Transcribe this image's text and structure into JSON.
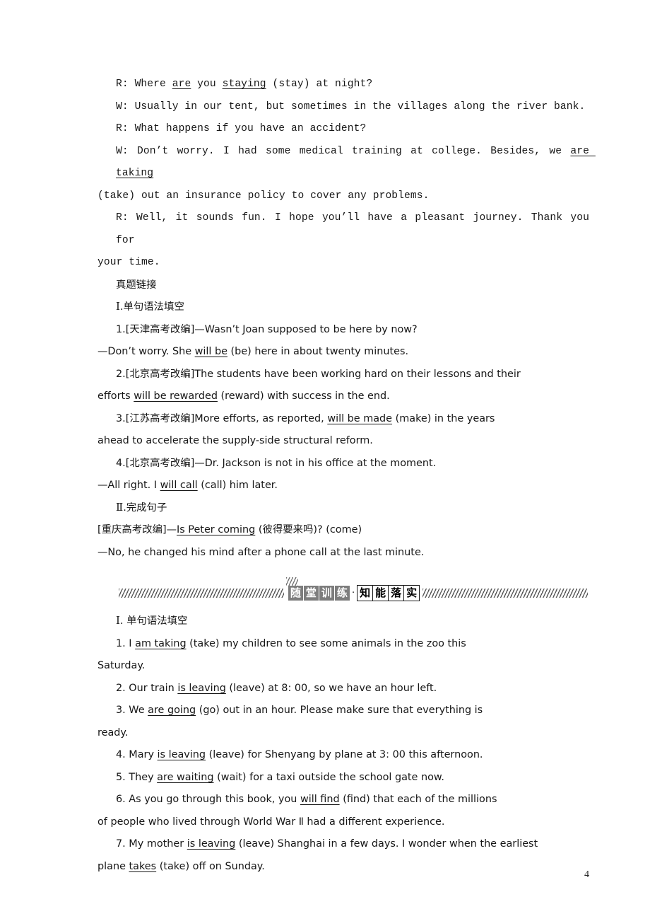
{
  "page": {
    "number": "4"
  },
  "dialogue": {
    "lines": [
      {
        "indent": true,
        "parts": [
          {
            "t": "R: Where "
          },
          {
            "t": "are",
            "u": true
          },
          {
            "t": " you "
          },
          {
            "t": "staying",
            "u": true
          },
          {
            "t": " (stay) at night?"
          }
        ],
        "justify": false
      },
      {
        "indent": true,
        "parts": [
          {
            "t": "W: Usually in our tent, but sometimes in the villages along the river bank."
          }
        ],
        "justify": false
      },
      {
        "indent": true,
        "parts": [
          {
            "t": "R: What happens if you have an accident?"
          }
        ],
        "justify": false
      },
      {
        "indent": true,
        "parts": [
          {
            "t": "W: Don’t worry. I had some medical training at college. Besides, we "
          },
          {
            "t": "are taking",
            "u": true
          }
        ],
        "justify": true
      },
      {
        "indent": false,
        "parts": [
          {
            "t": "(take) out an insurance policy to cover any problems."
          }
        ],
        "justify": false
      },
      {
        "indent": true,
        "parts": [
          {
            "t": "R: Well, it sounds fun. I hope you’ll have a pleasant journey. Thank you for"
          }
        ],
        "justify": true
      },
      {
        "indent": false,
        "parts": [
          {
            "t": "your time."
          }
        ],
        "justify": false
      }
    ]
  },
  "real_exam": {
    "heading": "真题链接",
    "section1_label": "Ⅰ",
    "section1_title": ".单句语法填空",
    "section2_label": "Ⅱ",
    "section2_title": ".完成句子",
    "items": [
      {
        "indent": true,
        "justify": false,
        "parts": [
          {
            "t": "1.[天津高考改编]—Wasn’t Joan supposed to be here by now?"
          }
        ]
      },
      {
        "indent": false,
        "justify": false,
        "parts": [
          {
            "t": "—Don’t worry. She "
          },
          {
            "t": "will be",
            "u": true
          },
          {
            "t": " (be) here in about twenty minutes."
          }
        ]
      },
      {
        "indent": true,
        "justify": true,
        "parts": [
          {
            "t": "2.[北京高考改编]The students have been working hard on their lessons and their"
          }
        ]
      },
      {
        "indent": false,
        "justify": false,
        "parts": [
          {
            "t": "efforts "
          },
          {
            "t": "will be rewarded",
            "u": true
          },
          {
            "t": " (reward) with success in the end."
          }
        ]
      },
      {
        "indent": true,
        "justify": true,
        "parts": [
          {
            "t": "3.[江苏高考改编]More efforts, as reported, "
          },
          {
            "t": "will be made",
            "u": true
          },
          {
            "t": " (make) in the years"
          }
        ]
      },
      {
        "indent": false,
        "justify": false,
        "parts": [
          {
            "t": "ahead to accelerate the supply-side structural reform."
          }
        ]
      },
      {
        "indent": true,
        "justify": false,
        "parts": [
          {
            "t": "4.[北京高考改编]—Dr. Jackson is not in his office at the moment."
          }
        ]
      },
      {
        "indent": false,
        "justify": false,
        "parts": [
          {
            "t": "—All right. I "
          },
          {
            "t": "will call",
            "u": true
          },
          {
            "t": " (call) him later."
          }
        ]
      }
    ],
    "items2": [
      {
        "indent": false,
        "justify": false,
        "parts": [
          {
            "t": "[重庆高考改编]—"
          },
          {
            "t": "Is Peter coming",
            "u": true
          },
          {
            "t": " (彼得要来吗)? (come)"
          }
        ]
      },
      {
        "indent": false,
        "justify": false,
        "parts": [
          {
            "t": "—No, he changed his mind after a phone call at the last minute."
          }
        ]
      }
    ]
  },
  "banner": {
    "dark_chars": [
      "随",
      "堂",
      "训",
      "练"
    ],
    "separator": "·",
    "light_chars": [
      "知",
      "能",
      "落",
      "实"
    ]
  },
  "practice": {
    "section_label": "Ⅰ",
    "section_title": ". 单句语法填空",
    "items": [
      {
        "indent": true,
        "justify": true,
        "parts": [
          {
            "t": "1. I "
          },
          {
            "t": "am taking",
            "u": true
          },
          {
            "t": " (take) my children to see some animals in the zoo this"
          }
        ]
      },
      {
        "indent": false,
        "justify": false,
        "parts": [
          {
            "t": "Saturday."
          }
        ]
      },
      {
        "indent": true,
        "justify": false,
        "parts": [
          {
            "t": "2. Our train "
          },
          {
            "t": "is leaving",
            "u": true
          },
          {
            "t": " (leave) at 8: 00, so we have an hour left."
          }
        ]
      },
      {
        "indent": true,
        "justify": true,
        "parts": [
          {
            "t": "3. We "
          },
          {
            "t": "are going",
            "u": true
          },
          {
            "t": " (go) out in an hour. Please make sure that everything is"
          }
        ]
      },
      {
        "indent": false,
        "justify": false,
        "parts": [
          {
            "t": "ready."
          }
        ]
      },
      {
        "indent": true,
        "justify": false,
        "parts": [
          {
            "t": "4. Mary "
          },
          {
            "t": "is leaving",
            "u": true
          },
          {
            "t": " (leave) for Shenyang by plane at 3: 00 this afternoon."
          }
        ]
      },
      {
        "indent": true,
        "justify": false,
        "parts": [
          {
            "t": "5. They "
          },
          {
            "t": "are waiting",
            "u": true
          },
          {
            "t": " (wait) for a taxi outside the school gate now."
          }
        ]
      },
      {
        "indent": true,
        "justify": true,
        "parts": [
          {
            "t": "6. As you go through this book, you "
          },
          {
            "t": "will find",
            "u": true
          },
          {
            "t": " (find) that each of the millions"
          }
        ]
      },
      {
        "indent": false,
        "justify": false,
        "parts": [
          {
            "t": "of people who lived through World War Ⅱ had a different experience."
          }
        ]
      },
      {
        "indent": true,
        "justify": true,
        "parts": [
          {
            "t": "7. My mother "
          },
          {
            "t": "is leaving",
            "u": true
          },
          {
            "t": " (leave) Shanghai in a few days. I wonder when the earliest"
          }
        ]
      },
      {
        "indent": false,
        "justify": false,
        "parts": [
          {
            "t": "plane "
          },
          {
            "t": "takes",
            "u": true
          },
          {
            "t": " (take) off on Sunday."
          }
        ]
      }
    ]
  }
}
